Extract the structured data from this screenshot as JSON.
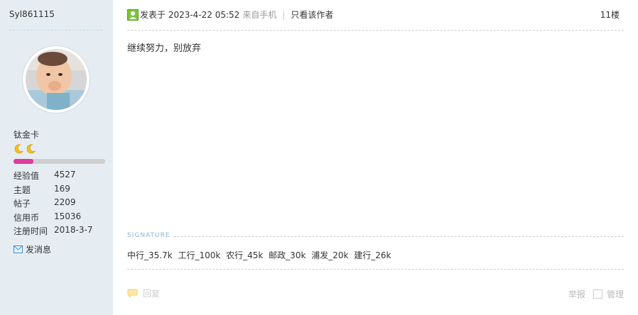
{
  "sidebar": {
    "username": "Syl861115",
    "level": "钛金卡",
    "level_progress_pct": 22,
    "stats": [
      {
        "label": "经验值",
        "value": "4527"
      },
      {
        "label": "主题",
        "value": "169"
      },
      {
        "label": "帖子",
        "value": "2209"
      },
      {
        "label": "信用币",
        "value": "15036"
      },
      {
        "label": "注册时间",
        "value": "2018-3-7"
      }
    ],
    "message_label": "发消息",
    "icons": {
      "moon": "moon-icon",
      "mail": "mail-icon",
      "avatar": "user-photo"
    }
  },
  "post": {
    "posted_label": "发表于 2023-4-22 05:52",
    "via": "来自手机",
    "sep": "|",
    "only_author": "只看该作者",
    "floor": "11楼",
    "content": "继续努力，别放弃",
    "signature_title": "SIGNATURE",
    "signature": "中行_35.7k 工行_100k 农行_45k 邮政_30k 浦发_20k 建行_26k",
    "reply": "回复",
    "report": "举报",
    "manage": "管理"
  },
  "colors": {
    "sidebar_bg": "#e5edf2",
    "progress": "#e13ba0",
    "accent_green": "#7fc33b"
  }
}
